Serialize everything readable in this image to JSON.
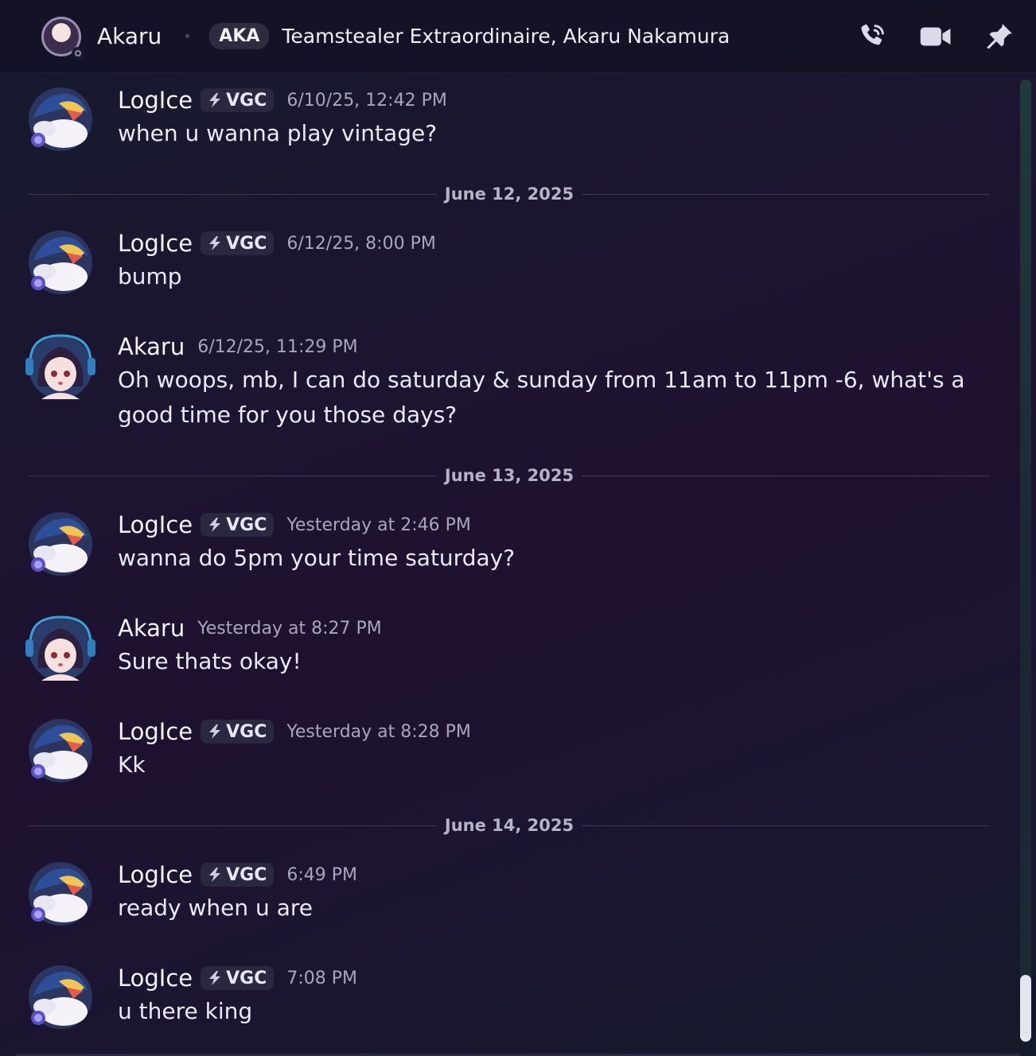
{
  "header": {
    "name": "Akaru",
    "aka_label": "AKA",
    "aka_text": "Teamstealer Extraordinaire, Akaru Nakamura",
    "icons": [
      "phone-call-icon",
      "video-camera-icon",
      "pin-icon"
    ]
  },
  "dividers": [
    "June 12, 2025",
    "June 13, 2025",
    "June 14, 2025"
  ],
  "messages": [
    {
      "author": "LogIce",
      "tag": "VGC",
      "time": "6/10/25, 12:42 PM",
      "text": "when u wanna play vintage?"
    },
    {
      "author": "LogIce",
      "tag": "VGC",
      "time": "6/12/25, 8:00 PM",
      "text": "bump"
    },
    {
      "author": "Akaru",
      "tag": "",
      "time": "6/12/25, 11:29 PM",
      "text": "Oh woops, mb, I can do saturday & sunday from 11am to 11pm -6, what's a good time for you those days?"
    },
    {
      "author": "LogIce",
      "tag": "VGC",
      "time": "Yesterday at 2:46 PM",
      "text": "wanna do 5pm your time saturday?"
    },
    {
      "author": "Akaru",
      "tag": "",
      "time": "Yesterday at 8:27 PM",
      "text": "Sure thats okay!"
    },
    {
      "author": "LogIce",
      "tag": "VGC",
      "time": "Yesterday at 8:28 PM",
      "text": "Kk"
    },
    {
      "author": "LogIce",
      "tag": "VGC",
      "time": "6:49 PM",
      "text": "ready when u are"
    },
    {
      "author": "LogIce",
      "tag": "VGC",
      "time": "7:08 PM",
      "text": "u there king"
    }
  ],
  "colors": {
    "background": "#1c1530",
    "text": "#ebe9f4",
    "timestamp": "#a9a6bb",
    "tag_bg": "#2a2840"
  }
}
